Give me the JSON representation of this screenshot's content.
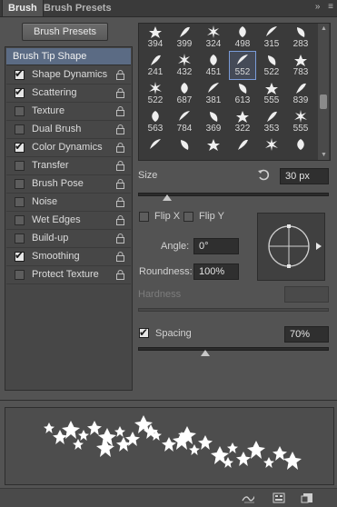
{
  "tabs": [
    {
      "label": "Brush"
    },
    {
      "label": "Brush Presets"
    }
  ],
  "tabbar_icons": {
    "expand": "»",
    "menu": "≡"
  },
  "presets_button": "Brush Presets",
  "left_options": {
    "tip_shape": "Brush Tip Shape",
    "items": [
      {
        "label": "Shape Dynamics",
        "checked": true
      },
      {
        "label": "Scattering",
        "checked": true
      },
      {
        "label": "Texture",
        "checked": false
      },
      {
        "label": "Dual Brush",
        "checked": false
      },
      {
        "label": "Color Dynamics",
        "checked": true
      },
      {
        "label": "Transfer",
        "checked": false
      },
      {
        "label": "Brush Pose",
        "checked": false
      },
      {
        "label": "Noise",
        "checked": false
      },
      {
        "label": "Wet Edges",
        "checked": false
      },
      {
        "label": "Build-up",
        "checked": false
      },
      {
        "label": "Smoothing",
        "checked": true
      },
      {
        "label": "Protect Texture",
        "checked": false
      }
    ]
  },
  "brush_grid": {
    "sizes": [
      "394",
      "399",
      "324",
      "498",
      "315",
      "283",
      "241",
      "432",
      "451",
      "552",
      "522",
      "783",
      "522",
      "687",
      "381",
      "613",
      "555",
      "839",
      "563",
      "784",
      "369",
      "322",
      "353",
      "555",
      "",
      "",
      "",
      "",
      "",
      ""
    ],
    "selected_index": 9
  },
  "size": {
    "label": "Size",
    "value": "30 px",
    "fraction": 0.15
  },
  "flip": {
    "x_label": "Flip X",
    "y_label": "Flip Y"
  },
  "angle": {
    "label": "Angle:",
    "value": "0°"
  },
  "roundness": {
    "label": "Roundness:",
    "value": "100%"
  },
  "hardness": {
    "label": "Hardness",
    "value": ""
  },
  "spacing": {
    "label": "Spacing",
    "value": "70%",
    "checked": true,
    "fraction": 0.35
  }
}
